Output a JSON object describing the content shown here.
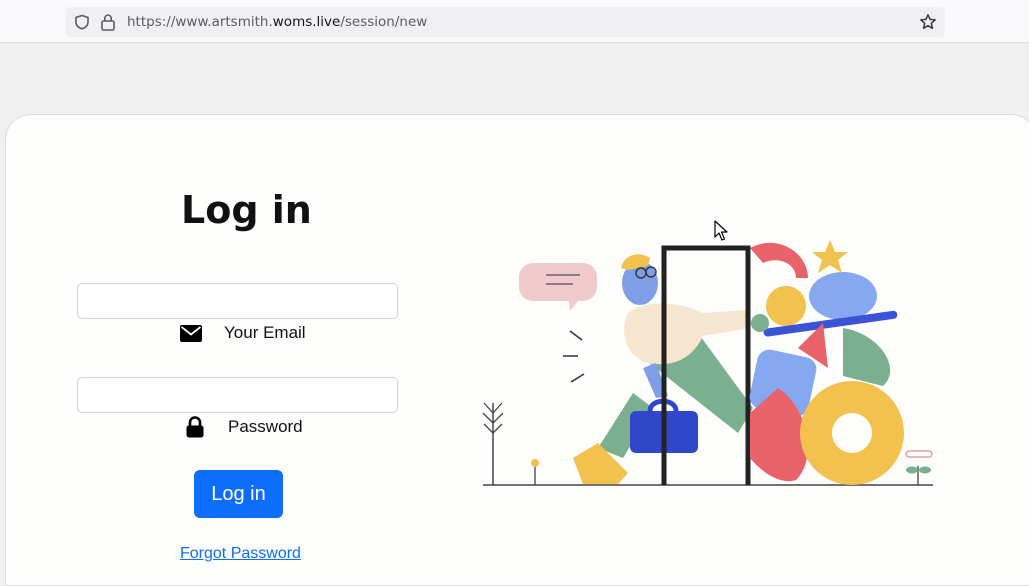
{
  "browser": {
    "url_prefix": "https://www.artsmith.",
    "url_domain": "woms.live",
    "url_path": "/session/new"
  },
  "login": {
    "title": "Log in",
    "email_label": "Your Email",
    "email_value": "",
    "password_label": "Password",
    "password_value": "",
    "button_label": "Log in",
    "forgot_label": "Forgot Password"
  },
  "colors": {
    "primary": "#0d6efd",
    "page_bg": "#fdfdfc"
  },
  "icons": {
    "shield": "shield-icon",
    "lock": "lock-icon",
    "star": "bookmark-star-icon",
    "email": "envelope-icon",
    "password": "padlock-icon"
  }
}
